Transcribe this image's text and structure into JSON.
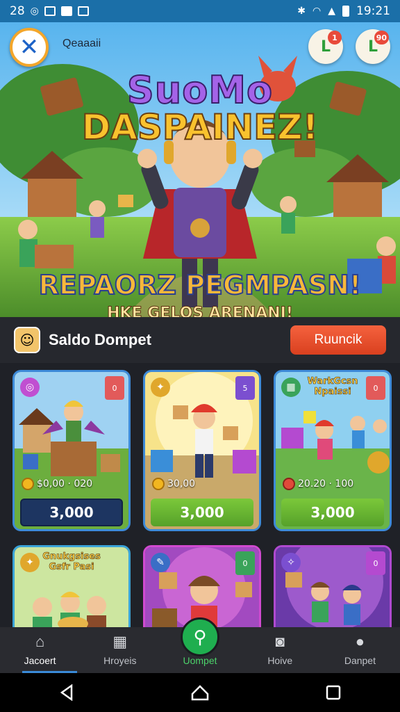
{
  "status_bar": {
    "time_left": "28",
    "time": "19:21",
    "left_icons": [
      "android-debug-icon",
      "gallery-icon",
      "notification-icon"
    ],
    "right_icons": [
      "bluetooth-icon",
      "wifi-icon",
      "signal-icon",
      "battery-icon"
    ]
  },
  "hero": {
    "user_label": "Qeaaaii",
    "title_line1": "SuoMo",
    "title_line2": "DASPAINEZ!",
    "banner_line1": "REPAORZ PEGMPASN!",
    "banner_line2": "HKE GELOS ARENANI!",
    "badge_left_count": "1",
    "badge_right_count": "90",
    "badge_left_symbol": "L",
    "badge_right_symbol": "L"
  },
  "wallet_section": {
    "title": "Saldo Dompet",
    "action_label": "Ruuncik"
  },
  "cards": [
    {
      "title": "",
      "tag": "0",
      "amount": "$0,00 · 020",
      "price": "3,000",
      "price_style": "navy"
    },
    {
      "title": "",
      "tag": "5",
      "amount": "30,00",
      "price": "3,000",
      "price_style": "green"
    },
    {
      "title": "WarkGcsn Npaissi",
      "tag": "0",
      "amount": "20.20 · 100",
      "price": "3,000",
      "price_style": "green"
    },
    {
      "title": "Gnukgsises Gsfr Pasi",
      "tag": "",
      "amount": "",
      "price": "",
      "price_style": "none"
    },
    {
      "title": "",
      "tag": "0",
      "amount": "",
      "price": "",
      "price_style": "none"
    },
    {
      "title": "",
      "tag": "0",
      "amount": "",
      "price": "",
      "price_style": "none"
    }
  ],
  "bottom_nav": [
    {
      "label": "Jacoert",
      "icon": "home-icon"
    },
    {
      "label": "Hroyeis",
      "icon": "calendar-icon"
    },
    {
      "label": "Uompet",
      "icon": "search-icon"
    },
    {
      "label": "Hoive",
      "icon": "camera-icon"
    },
    {
      "label": "Danpet",
      "icon": "profile-icon"
    }
  ],
  "system_nav": [
    "back-icon",
    "home-icon",
    "recents-icon"
  ],
  "colors": {
    "status_bar": "#1b6fa8",
    "accent_orange": "#e84e2c",
    "accent_green": "#1fae4f",
    "card_border": "#3d8ad8"
  }
}
